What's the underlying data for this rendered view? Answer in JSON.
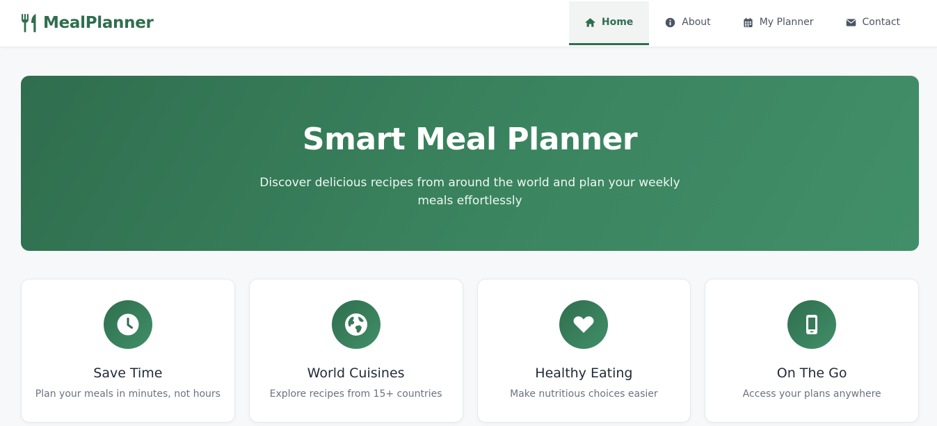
{
  "app": {
    "brand_name": "MealPlanner",
    "brand_icon": "utensils-icon",
    "accent_color": "#2f6e4e"
  },
  "nav": {
    "items": [
      {
        "label": "Home",
        "icon": "home-icon",
        "active": true
      },
      {
        "label": "About",
        "icon": "info-icon",
        "active": false
      },
      {
        "label": "My Planner",
        "icon": "calendar-icon",
        "active": false
      },
      {
        "label": "Contact",
        "icon": "envelope-icon",
        "active": false
      }
    ]
  },
  "hero": {
    "title": "Smart Meal Planner",
    "subtitle": "Discover delicious recipes from around the world and plan your weekly meals effortlessly"
  },
  "features": [
    {
      "icon": "clock-icon",
      "title": "Save Time",
      "text": "Plan your meals in minutes, not hours"
    },
    {
      "icon": "globe-icon",
      "title": "World Cuisines",
      "text": "Explore recipes from 15+ countries"
    },
    {
      "icon": "heart-icon",
      "title": "Healthy Eating",
      "text": "Make nutritious choices easier"
    },
    {
      "icon": "mobile-icon",
      "title": "On The Go",
      "text": "Access your plans anywhere"
    }
  ]
}
